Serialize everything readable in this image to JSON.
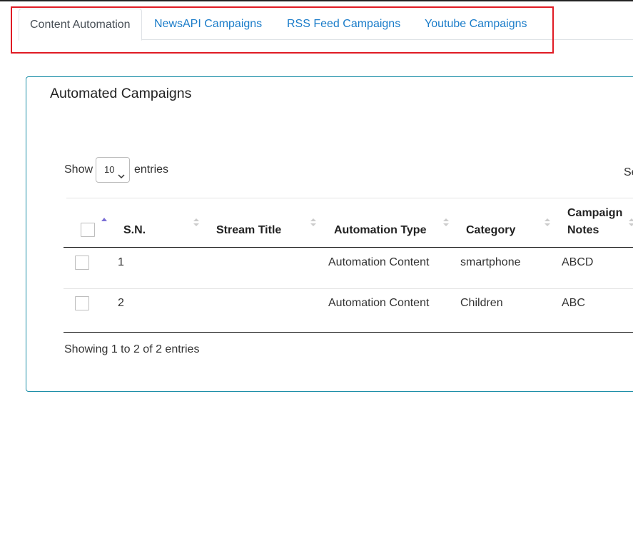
{
  "tabs": [
    {
      "label": "Content Automation",
      "active": true
    },
    {
      "label": "NewsAPI Campaigns",
      "active": false
    },
    {
      "label": "RSS Feed Campaigns",
      "active": false
    },
    {
      "label": "Youtube Campaigns",
      "active": false
    }
  ],
  "card": {
    "title": "Automated Campaigns",
    "show_label": "Show",
    "entries_value": "10",
    "entries_label": "entries",
    "search_label": "Se"
  },
  "table": {
    "headers": [
      "S.N.",
      "Stream Title",
      "Automation Type",
      "Category",
      "Campaign",
      "Notes"
    ],
    "rows": [
      {
        "sn": "1",
        "stream_title": "",
        "automation_type": "Automation Content",
        "category": "smartphone",
        "campaign_notes": "ABCD"
      },
      {
        "sn": "2",
        "stream_title": "",
        "automation_type": "Automation Content",
        "category": "Children",
        "campaign_notes": "ABC"
      }
    ],
    "info": "Showing 1 to 2 of 2 entries"
  },
  "colors": {
    "tab_link": "#1a7cc9",
    "highlight": "#e01b24",
    "card_border": "#1d8fa8",
    "sort_active": "#7b6fd6"
  }
}
